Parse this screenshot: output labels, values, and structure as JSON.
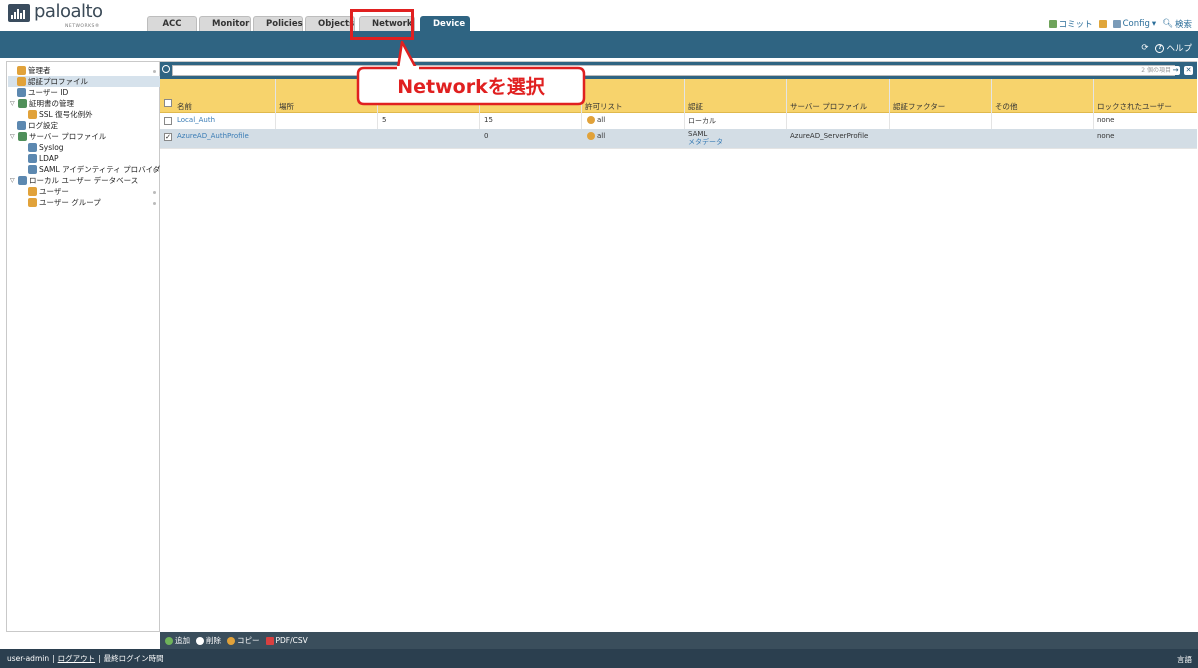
{
  "brand": {
    "name": "paloalto",
    "sub": "NETWORKS®"
  },
  "tabs": [
    {
      "label": "ACC",
      "active": false
    },
    {
      "label": "Monitor",
      "active": false
    },
    {
      "label": "Policies",
      "active": false
    },
    {
      "label": "Objects",
      "active": false
    },
    {
      "label": "Network",
      "active": false,
      "highlighted": true
    },
    {
      "label": "Device",
      "active": true
    }
  ],
  "top_actions": {
    "commit": "コミット",
    "config": "Config",
    "search": "検索"
  },
  "band_actions": {
    "help": "ヘルプ"
  },
  "sidebar": {
    "items": [
      {
        "label": "管理者"
      },
      {
        "label": "認証プロファイル",
        "selected": true
      },
      {
        "label": "ユーザー ID"
      },
      {
        "label": "証明書の管理"
      },
      {
        "label": "SSL 復号化例外"
      },
      {
        "label": "ログ設定"
      },
      {
        "label": "サーバー プロファイル"
      },
      {
        "label": "Syslog"
      },
      {
        "label": "LDAP"
      },
      {
        "label": "SAML アイデンティティ プロバイダ"
      },
      {
        "label": "ローカル ユーザー データベース"
      },
      {
        "label": "ユーザー"
      },
      {
        "label": "ユーザー グループ"
      }
    ]
  },
  "filter": {
    "count_text": "2 個の項目"
  },
  "table": {
    "columns": [
      "名前",
      "場所",
      "",
      "",
      "許可リスト",
      "認証",
      "サーバー プロファイル",
      "認証ファクター",
      "その他",
      "ロックされたユーザー"
    ],
    "rows": [
      {
        "checked": false,
        "name": "Local_Auth",
        "c3": "5",
        "c4": "15",
        "allow": "all",
        "auth": "ローカル",
        "auth_sub": "",
        "server": "",
        "locked": "none"
      },
      {
        "checked": true,
        "name": "AzureAD_AuthProfile",
        "c3": "",
        "c4": "0",
        "allow": "all",
        "auth": "SAML",
        "auth_sub": "メタデータ",
        "server": "AzureAD_ServerProfile",
        "locked": "none"
      }
    ]
  },
  "bottom_actions": {
    "add": "追加",
    "delete": "削除",
    "copy": "コピー",
    "pdf": "PDF/CSV"
  },
  "status": {
    "user": "user-admin",
    "sep1": "|",
    "logout": "ログアウト",
    "sep2": "|",
    "last_login": "最終ログイン時間",
    "lang": "言語"
  },
  "annotation": {
    "text": "Networkを選択"
  }
}
